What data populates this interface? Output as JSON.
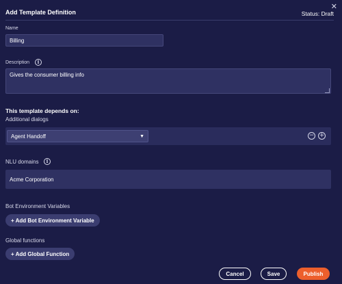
{
  "header": {
    "title": "Add Template Definition",
    "status": "Status: Draft",
    "close_glyph": "✕"
  },
  "name_field": {
    "label": "Name",
    "value": "Billing"
  },
  "description_field": {
    "label": "Description",
    "value": "Gives the consumer billing info",
    "info_glyph": "i"
  },
  "depends": {
    "heading": "This template depends on:",
    "additional_dialogs_label": "Additional dialogs",
    "selected_dialog": "Agent Handoff",
    "remove_glyph": "−",
    "add_glyph": "+"
  },
  "nlu": {
    "label": "NLU domains",
    "value": "Acme Corporation",
    "info_glyph": "i"
  },
  "bot_env": {
    "label": "Bot Environment Variables",
    "button": "+ Add Bot Environment Variable"
  },
  "global_functions": {
    "label": "Global functions",
    "button": "+ Add Global Function"
  },
  "footer": {
    "cancel": "Cancel",
    "save": "Save",
    "publish": "Publish"
  },
  "colors": {
    "background": "#1b1c46",
    "accent": "#ed5f2c",
    "field": "#2f3162"
  }
}
